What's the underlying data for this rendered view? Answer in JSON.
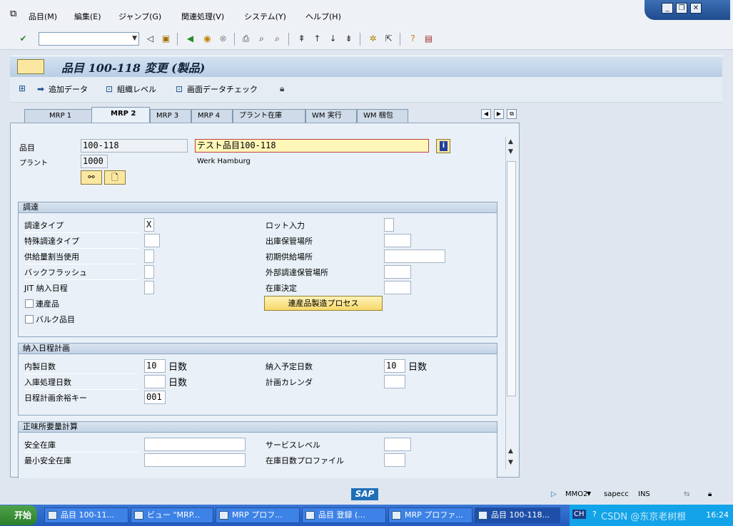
{
  "menu": [
    "品目(M)",
    "編集(E)",
    "ジャンプ(G)",
    "関連処理(V)",
    "システム(Y)",
    "ヘルプ(H)"
  ],
  "title": "品目 100-118 変更 (製品)",
  "app_toolbar": {
    "add_data": "追加データ",
    "org_levels": "組織レベル",
    "check_screen": "画面データチェック"
  },
  "tabs": [
    "MRP 1",
    "MRP 2",
    "MRP 3",
    "MRP 4",
    "プラント在庫",
    "WM 実行",
    "WM 梱包"
  ],
  "active_tab": "MRP 2",
  "header": {
    "material_label": "品目",
    "material_value": "100-118",
    "material_desc": "テスト品目100-118",
    "plant_label": "プラント",
    "plant_value": "1000",
    "plant_name": "Werk Hamburg"
  },
  "procurement": {
    "title": "調達",
    "procurement_type_label": "調達タイプ",
    "procurement_type_value": "X",
    "special_procurement_label": "特殊調達タイプ",
    "quota_label": "供給量割当使用",
    "backflush_label": "バックフラッシュ",
    "jit_label": "JIT 納入日程",
    "coproduct_label": "連産品",
    "bulk_label": "バルク品目",
    "batch_entry_label": "ロット入力",
    "prod_storage_label": "出庫保管場所",
    "default_supply_label": "初期供給場所",
    "ext_storage_label": "外部調達保管場所",
    "stock_determination_label": "在庫決定",
    "coproduct_button": "連産品製造プロセス"
  },
  "scheduling": {
    "title": "納入日程計画",
    "inhouse_label": "内製日数",
    "inhouse_value": "10",
    "gr_label": "入庫処理日数",
    "sm_key_label": "日程計画余裕キー",
    "sm_key_value": "001",
    "planned_delivery_label": "納入予定日数",
    "planned_delivery_value": "10",
    "planning_calendar_label": "計画カレンダ",
    "days_unit": "日数"
  },
  "net_req": {
    "title": "正味所要量計算",
    "safety_stock_label": "安全在庫",
    "min_safety_label": "最小安全在庫",
    "service_level_label": "サービスレベル",
    "coverage_label": "在庫日数プロファイル"
  },
  "status": {
    "session": "MMO2",
    "server": "sapecc",
    "mode": "INS"
  },
  "taskbar": {
    "start": "开始",
    "items": [
      "品目 100-11...",
      "ビュー \"MRP...",
      "MRP プロフ...",
      "品目 登録 (...",
      "MRP プロファ...",
      "品目 100-118..."
    ],
    "lang": "CH",
    "clock": "16:24",
    "watermark": "CSDN @东京老树根"
  }
}
